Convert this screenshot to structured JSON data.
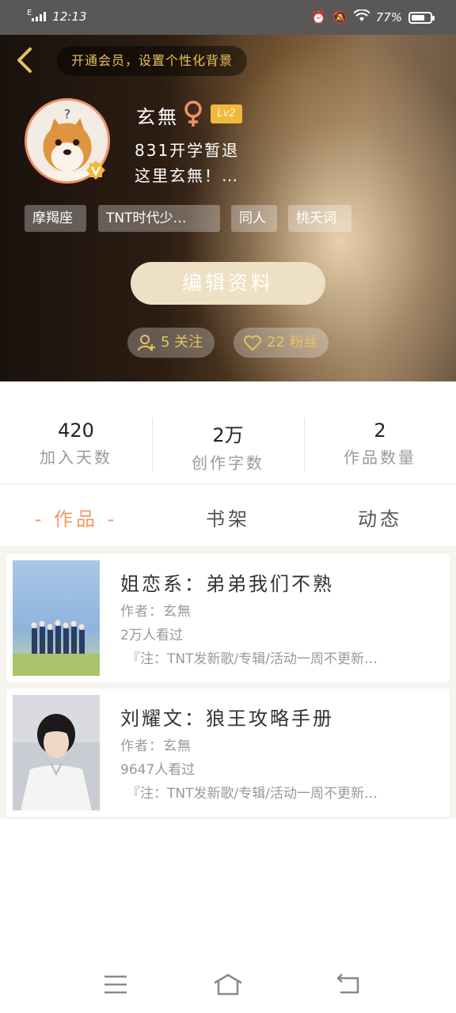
{
  "status_bar": {
    "network": "E",
    "time": "12:13",
    "battery": "77%"
  },
  "header": {
    "vip_banner": "开通会员，设置个性化背景",
    "username": "玄無",
    "level": "Lv2",
    "bio_line1": "831开学暂退",
    "bio_line2": "这里玄無！…",
    "tags": [
      "摩羯座",
      "TNT时代少…",
      "同人",
      "桃夭词"
    ],
    "edit_button": "编辑资料",
    "following": "5 关注",
    "fans": "22 粉丝",
    "colors": {
      "accent_gold": "#e6c35e",
      "level_badge": "#f2b83c",
      "avatar_border": "#f0906a"
    }
  },
  "stats": [
    {
      "value": "420",
      "label": "加入天数"
    },
    {
      "value": "2万",
      "label": "创作字数"
    },
    {
      "value": "2",
      "label": "作品数量"
    }
  ],
  "tabs": [
    {
      "label": "- 作品 -",
      "active": true
    },
    {
      "label": "书架",
      "active": false
    },
    {
      "label": "动态",
      "active": false
    }
  ],
  "works": [
    {
      "title": "姐恋系：弟弟我们不熟",
      "author": "作者：玄無",
      "views": "2万人看过",
      "note": "『注：TNT发新歌/专辑/活动一周不更新…"
    },
    {
      "title": "刘耀文：狼王攻略手册",
      "author": "作者：玄無",
      "views": "9647人看过",
      "note": "『注：TNT发新歌/专辑/活动一周不更新…"
    }
  ],
  "icons": [
    "back-arrow-icon",
    "female-icon",
    "verified-v-icon",
    "follow-user-icon",
    "heart-icon",
    "menu-icon",
    "home-icon",
    "back-icon"
  ]
}
